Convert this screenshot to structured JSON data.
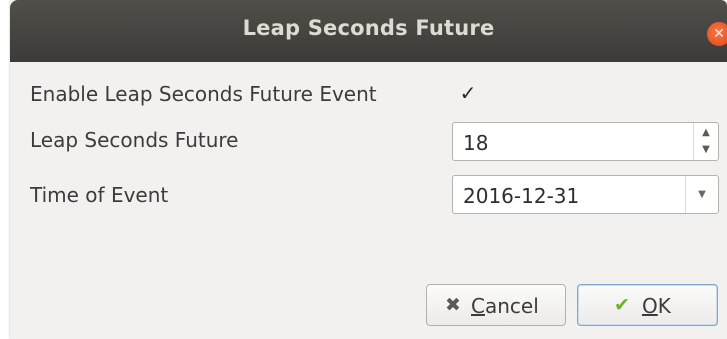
{
  "window": {
    "title": "Leap Seconds Future",
    "close_icon": "close-icon"
  },
  "form": {
    "enable_label": "Enable Leap Seconds Future Event",
    "enable_checked": true,
    "enable_check_glyph": "✓",
    "leap_label": "Leap Seconds Future",
    "leap_value": "18",
    "time_label": "Time of Event",
    "time_value": "2016-12-31"
  },
  "buttons": {
    "cancel_mnemonic": "C",
    "cancel_rest": "ancel",
    "ok_mnemonic": "O",
    "ok_rest": "K",
    "cancel_icon": "cancel-x-icon",
    "ok_icon": "checkmark-icon"
  },
  "colors": {
    "titlebar": "#3c3b37",
    "close_button": "#e95420",
    "dialog_background": "#f2f1f0",
    "ok_check": "#6ab42a",
    "ok_border": "#7fa7d0"
  }
}
